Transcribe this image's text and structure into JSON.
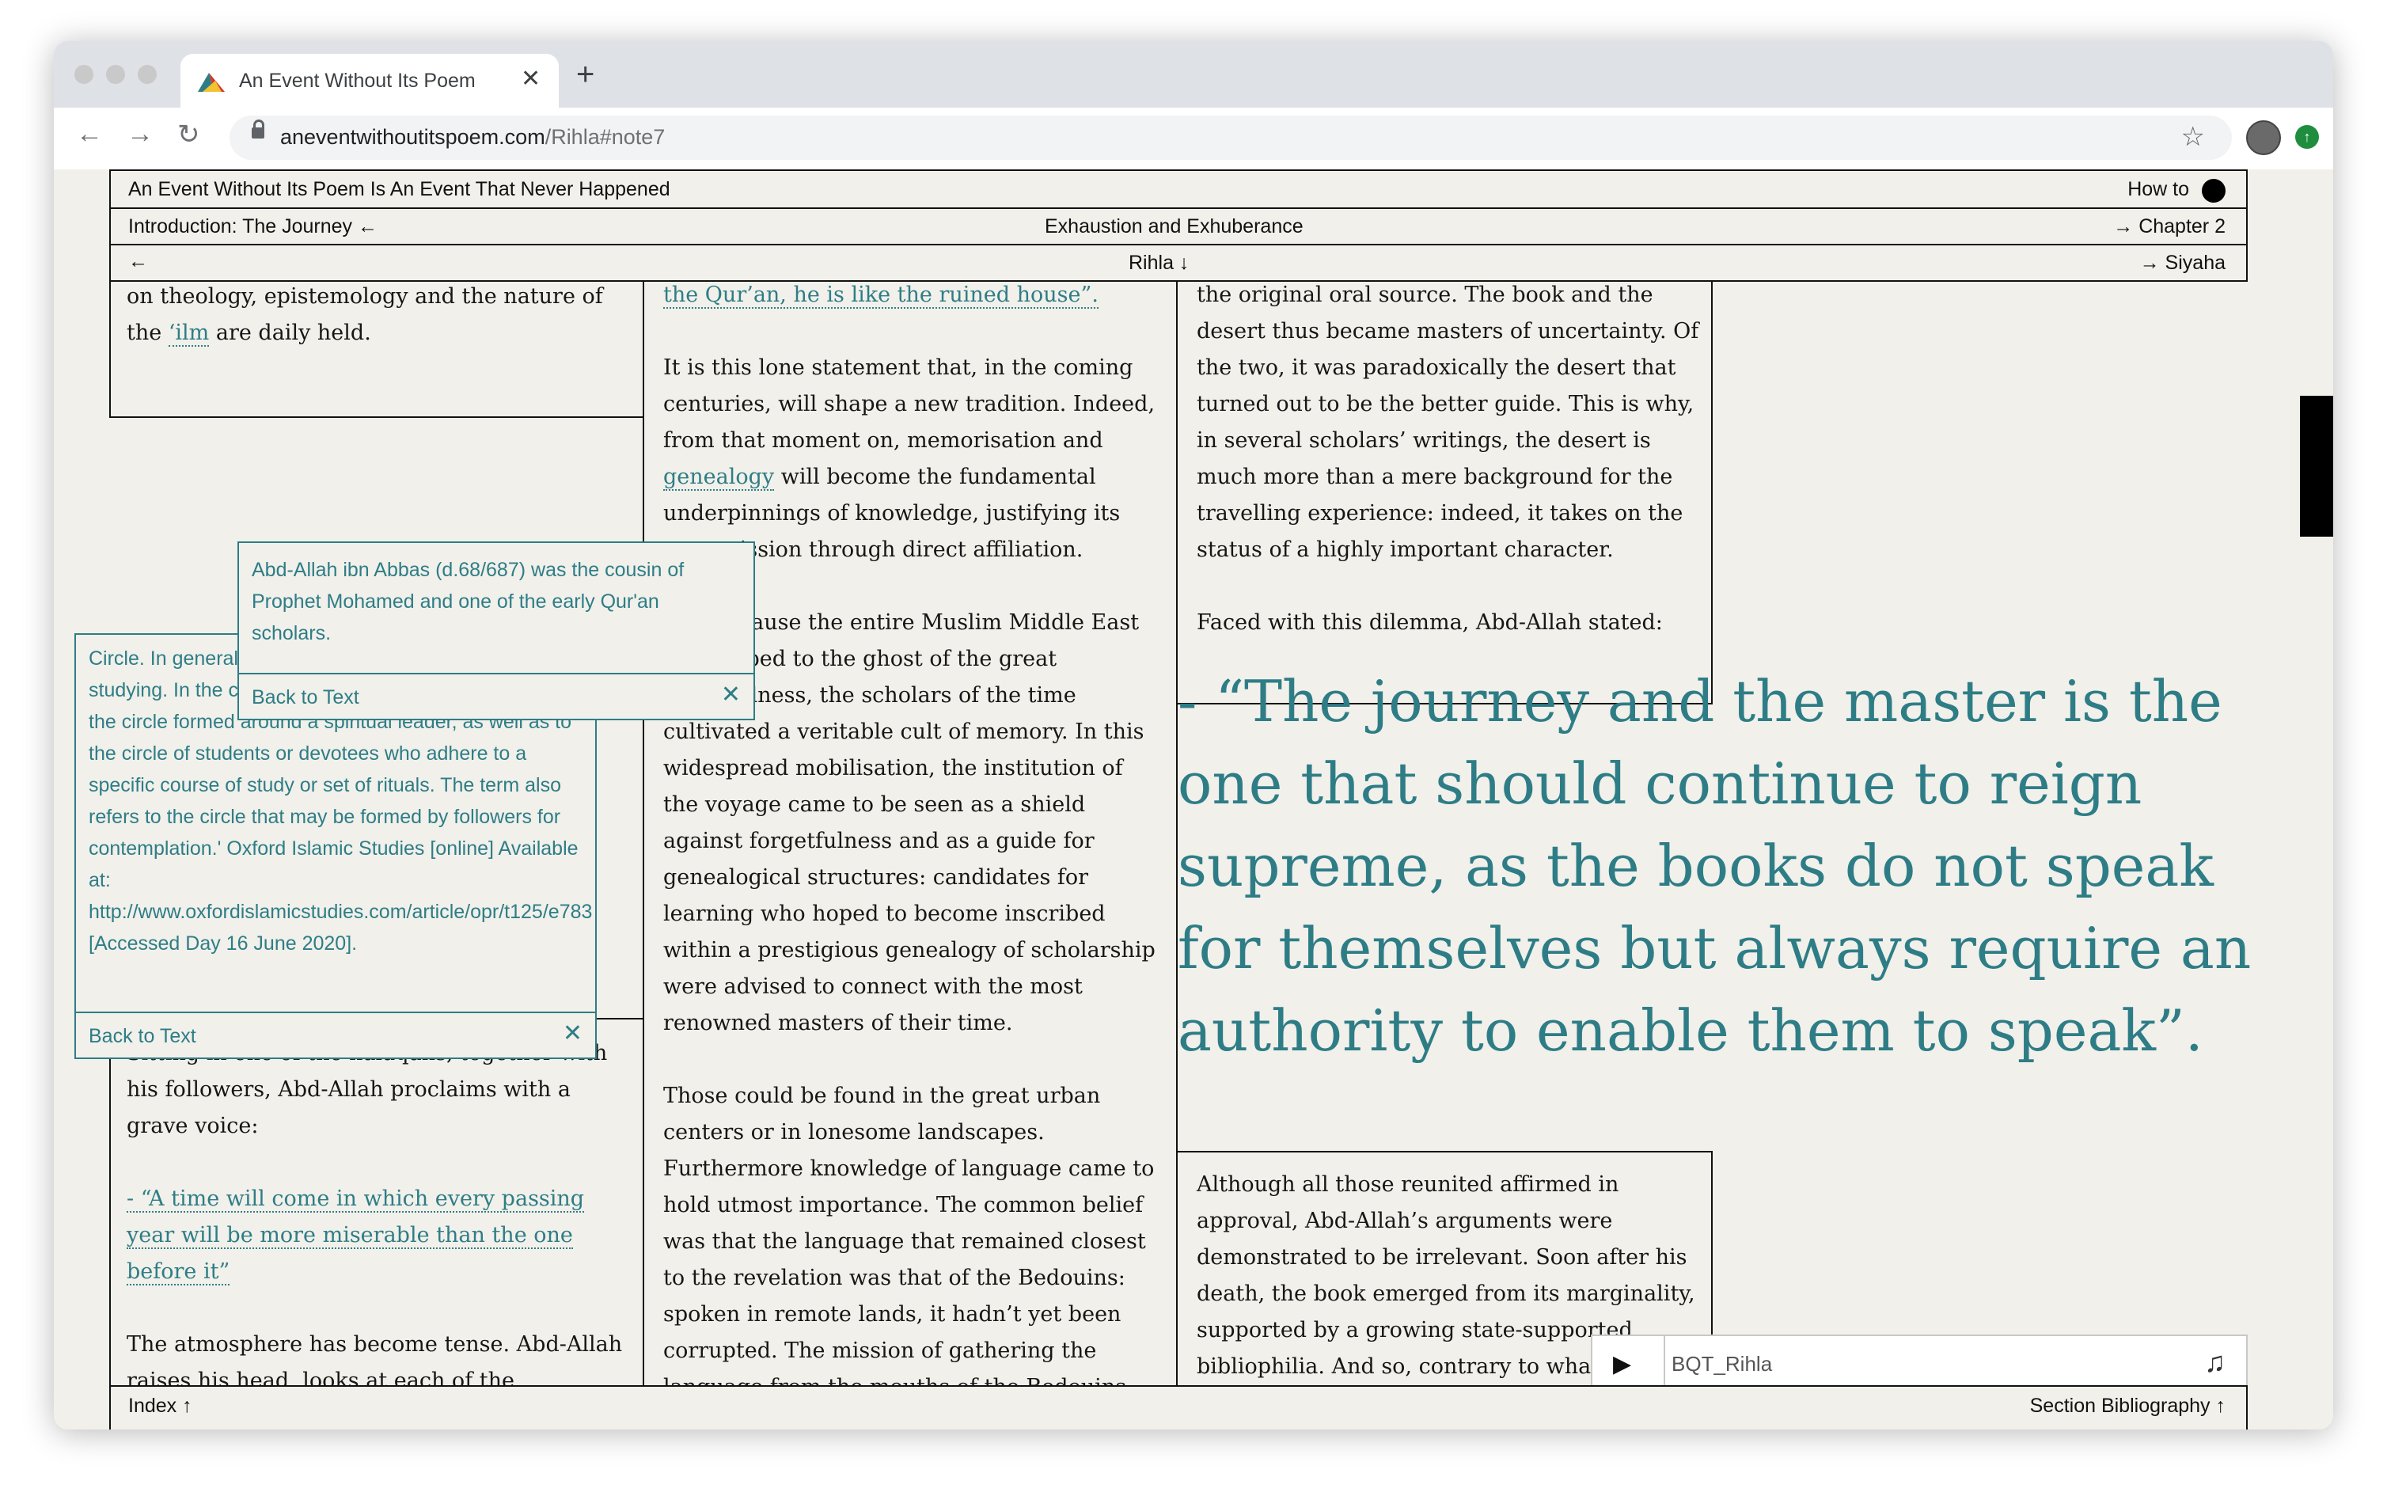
{
  "browser": {
    "tab_title": "An Event Without Its Poem",
    "url_host": "aneventwithoutitspoem.com",
    "url_path": "/Rihla#note7"
  },
  "site": {
    "title": "An Event Without Its Poem Is An Event That Never Happened",
    "how_to": "How to",
    "nav2": {
      "left": "Introduction: The Journey ←",
      "center": "Exhaustion and Exhuberance",
      "right": "→ Chapter 2"
    },
    "nav3": {
      "left": "←",
      "center": "Rihla ↓",
      "right": "→ Siyaha"
    }
  },
  "col1_top": {
    "text1": "on theology, epistemology and the nature of the ",
    "ilm": "‘ilm",
    "text2": " are daily held."
  },
  "col1_bottom": {
    "para1": "Sitting in one of the halaqahs, together with his followers, Abd-Allah proclaims with a grave voice:",
    "quote": "- “A time will come in which every passing year will be more miserable than the one before it”",
    "para2": "The atmosphere has become tense. Abd-Allah raises his head, looks at each of the"
  },
  "col2": {
    "quote_tail": "the Qur’an, he is like the ruined house”.",
    "p1_a": "It is this lone statement that, in the coming centuries, will shape a new tradition. Indeed, from that moment on, memorisation and ",
    "p1_link": "genealogy",
    "p1_b": " will become the fundamental underpinnings of knowledge, justifying its transmission through direct affiliation.",
    "p2": "And because the entire Muslim Middle East succumbed to the ghost of the great forgetfulness, the scholars of the time cultivated a veritable cult of memory. In this widespread mobilisation, the institution of the voyage came to be seen as a shield against forgetfulness and as a guide for genealogical structures: candidates for learning who hoped to become inscribed within a prestigious genealogy of scholarship were advised to connect with the most renowned masters of their time.",
    "p3": "Those could be found in the great urban centers or in lonesome landscapes. Furthermore knowledge of language came to hold utmost importance. The common belief was that the language that remained closest to the revelation was that of the Bedouins: spoken in remote lands, it hadn’t yet been corrupted. The mission of gathering the language from the mouths of the Bedouins"
  },
  "col3_top": {
    "p1": "the original oral source. The book and the desert thus became masters of uncertainty. Of the two, it was paradoxically the desert that turned out to be the better guide. This is why, in several scholars’ writings, the desert is much more than a mere background for the travelling experience: indeed, it takes on the status of a highly important character.",
    "p2": "Faced with this dilemma, Abd-Allah stated:"
  },
  "big_quote": "- “The journey and the master is the one that should continue to reign supreme, as the books do not speak for themselves but always require an authority to enable them to speak”.",
  "col3_bottom": {
    "p1": "Although all those reunited affirmed in approval, Abd-Allah’s arguments were demonstrated to be irrelevant. Soon after his death, the book emerged from its marginality, supported by a growing state-supported bibliophilia. And so, contrary to what was feared, the cycle of travelling was"
  },
  "note_circle": {
    "text": "Circle. In general, it refers to a gathering of students studying. In the context of Sufism, it is used to refer to the circle formed around a spiritual leader, as well as to the circle of students or devotees who adhere to a specific course of study or set of rituals. The term also refers to the circle that may be formed by followers for contemplation.' Oxford Islamic Studies [online] Available at: http://www.oxfordislamicstudies.com/article/opr/t125/e783 [Accessed Day 16 June 2020].",
    "back": "Back to Text"
  },
  "note_abbas": {
    "text": "Abd-Allah ibn Abbas (d.68/687) was the cousin of Prophet Mohamed and one of the early Qur'an scholars.",
    "back": "Back to Text"
  },
  "audio": {
    "title": "BQT_Rihla"
  },
  "footer": {
    "left": "Index ↑",
    "right": "Section Bibliography ↑"
  },
  "icons": [
    "back-arrow-icon",
    "forward-arrow-icon",
    "reload-icon",
    "lock-icon",
    "star-icon",
    "close-icon",
    "plus-icon",
    "play-icon",
    "music-note-icon",
    "circle-dot-icon"
  ],
  "colors": {
    "accent": "#2e7d86",
    "page_bg": "#f1f0ea",
    "text": "#161616"
  }
}
